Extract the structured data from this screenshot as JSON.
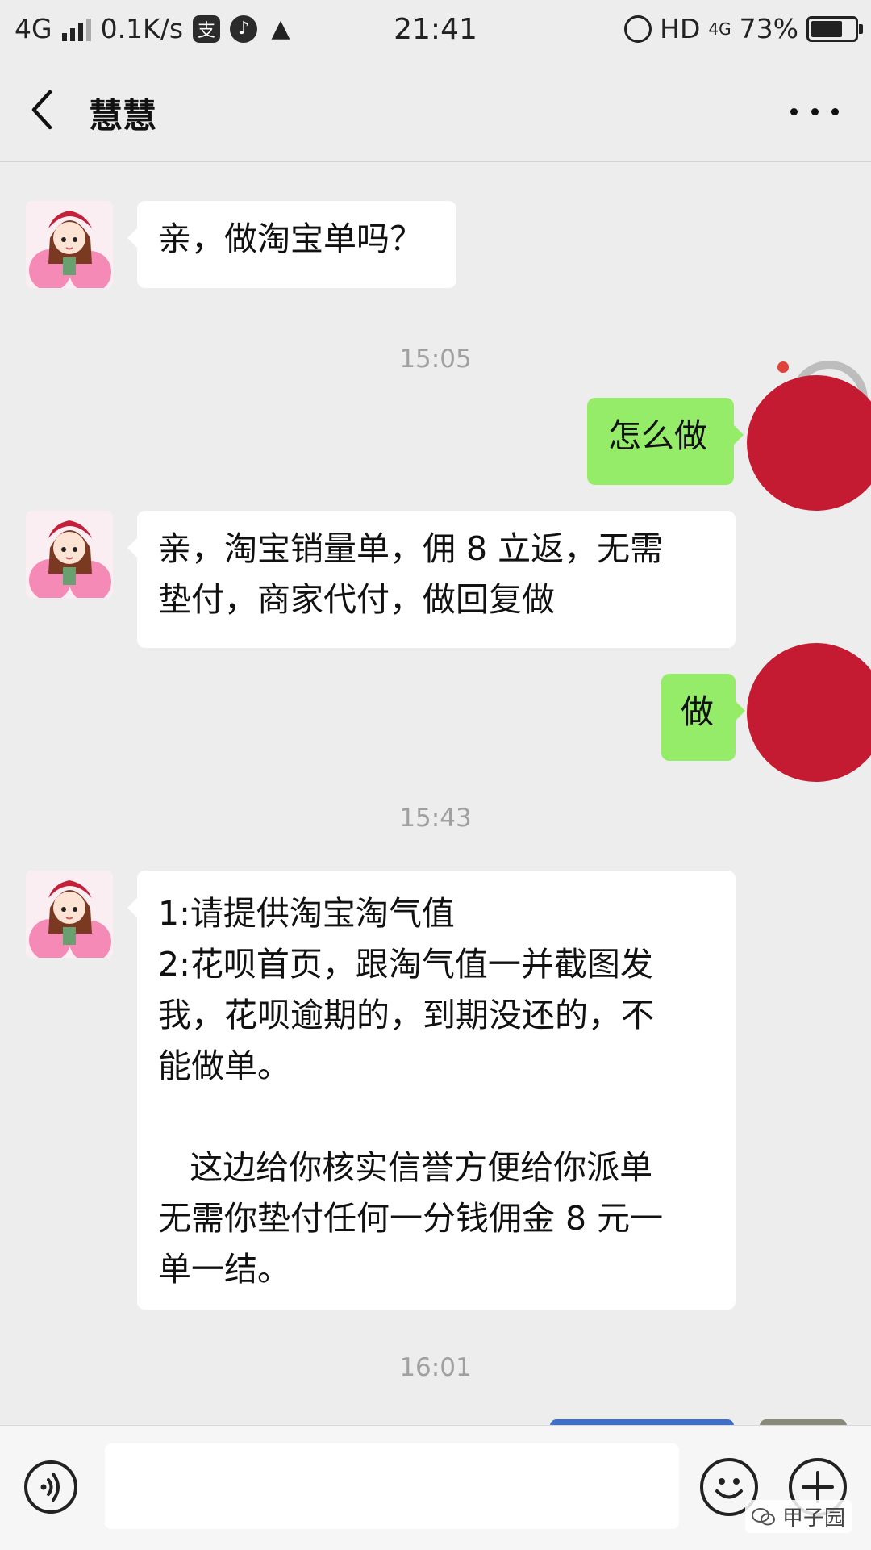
{
  "status_bar": {
    "network": "4G",
    "speed": "0.1K/s",
    "time": "21:41",
    "hd": "HD",
    "net2": "4G",
    "battery": "73%",
    "battery_level": 0.73,
    "icons": [
      "alipay-icon",
      "music-icon",
      "qq-icon",
      "alarm-icon",
      "battery-icon"
    ]
  },
  "nav": {
    "title": "慧慧",
    "back_icon": "chevron-left-icon",
    "more_icon": "more-dots-icon"
  },
  "messages": [
    {
      "side": "left",
      "lines": [
        "亲，做淘宝单吗？"
      ]
    },
    {
      "timestamp": "15:05"
    },
    {
      "side": "right",
      "lines": [
        "怎么做"
      ]
    },
    {
      "side": "left",
      "lines": [
        "亲，淘宝销量单，佣 8 立返，无需",
        "垫付，商家代付，做回复做"
      ]
    },
    {
      "side": "right",
      "lines": [
        "做"
      ]
    },
    {
      "timestamp": "15:43"
    },
    {
      "side": "left",
      "lines": [
        "1:请提供淘宝淘气值",
        "2:花呗首页，跟淘气值一并截图发",
        "我，花呗逾期的，到期没还的，不",
        "能做单。",
        "",
        "   这边给你核实信誉方便给你派单",
        "无需你垫付任何一分钱佣金 8 元一",
        "单一结。"
      ]
    },
    {
      "timestamp": "16:01"
    }
  ],
  "input_bar": {
    "placeholder": "",
    "voice_icon": "voice-icon",
    "emoji_icon": "emoji-icon",
    "plus_icon": "plus-icon"
  },
  "watermark": "甲子园",
  "colors": {
    "background": "#ededed",
    "sent_bubble": "#95ec69",
    "received_bubble": "#ffffff",
    "redaction": "#c41a32",
    "timestamp": "#a0a0a0"
  }
}
